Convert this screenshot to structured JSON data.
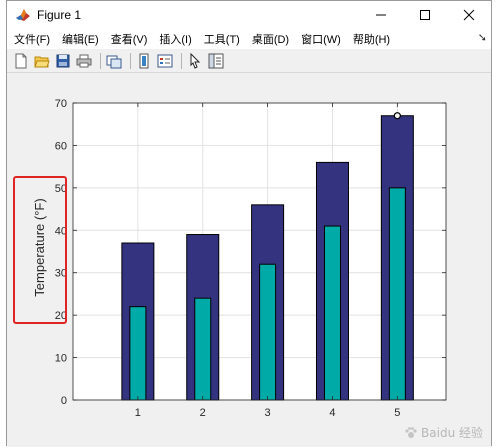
{
  "window": {
    "title": "Figure 1"
  },
  "menu": [
    "文件(F)",
    "编辑(E)",
    "查看(V)",
    "插入(I)",
    "工具(T)",
    "桌面(D)",
    "窗口(W)",
    "帮助(H)"
  ],
  "toolbar": {
    "icons": [
      "new-figure-icon",
      "open-file-icon",
      "save-icon",
      "print-icon",
      "link-plot-icon",
      "colorbar-icon",
      "legend-icon",
      "pointer-icon",
      "property-editor-icon"
    ]
  },
  "chart_data": {
    "type": "bar",
    "categories": [
      "1",
      "2",
      "3",
      "4",
      "5"
    ],
    "series": [
      {
        "values": [
          37,
          39,
          46,
          56,
          67
        ],
        "color": "#333380"
      },
      {
        "values": [
          22,
          24,
          32,
          41,
          50
        ],
        "color": "#00aaa6"
      }
    ],
    "ylabel": "Temperature (°F)",
    "xlabel": "",
    "ylim": [
      0,
      70
    ],
    "yticks": [
      "0",
      "10",
      "20",
      "30",
      "40",
      "50",
      "60",
      "70"
    ],
    "grid": true
  },
  "annotation": {
    "color": "#e02424"
  },
  "watermark": {
    "text": "Baidu 经验"
  }
}
